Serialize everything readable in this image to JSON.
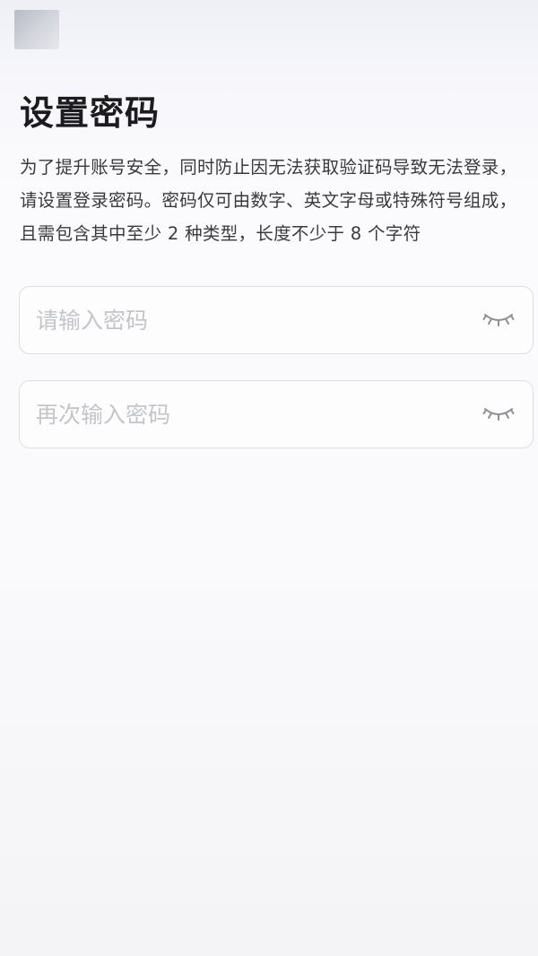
{
  "header": {
    "back_icon": "back-icon"
  },
  "page": {
    "title": "设置密码",
    "description": "为了提升账号安全，同时防止因无法获取验证码导致无法登录，请设置登录密码。密码仅可由数字、英文字母或特殊符号组成，且需包含其中至少 2 种类型，长度不少于 8 个字符"
  },
  "form": {
    "password_placeholder": "请输入密码",
    "confirm_placeholder": "再次输入密码",
    "visibility_icon": "eye-closed-icon"
  },
  "colors": {
    "title": "#1c1c1e",
    "text": "#3a3a3c",
    "placeholder": "#c4c5c9",
    "border": "#dddee3"
  }
}
